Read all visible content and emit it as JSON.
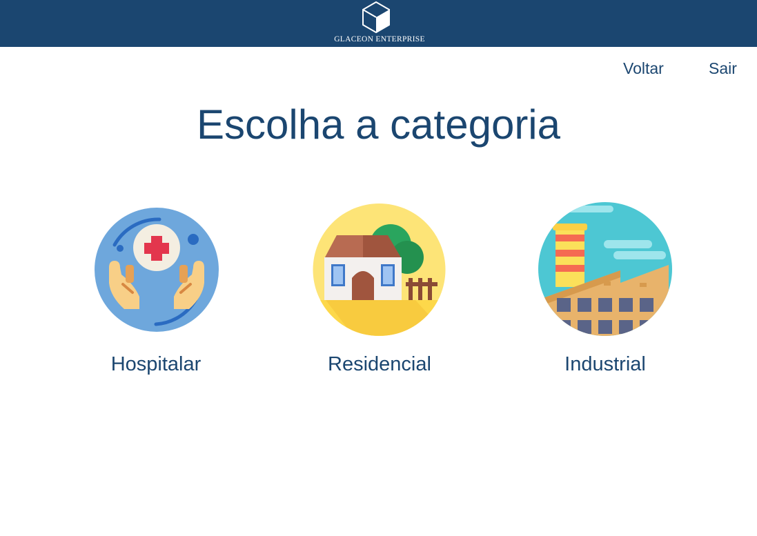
{
  "header": {
    "logo_text": "GLACEON ENTERPRISE",
    "background_color": "#1b4670"
  },
  "nav": {
    "back_label": "Voltar",
    "exit_label": "Sair"
  },
  "main": {
    "title": "Escolha a categoria",
    "categories": [
      {
        "label": "Hospitalar",
        "icon": "hands-medical-cross-icon"
      },
      {
        "label": "Residencial",
        "icon": "house-icon"
      },
      {
        "label": "Industrial",
        "icon": "factory-icon"
      }
    ]
  },
  "colors": {
    "primary": "#1b4670",
    "background": "#ffffff"
  }
}
